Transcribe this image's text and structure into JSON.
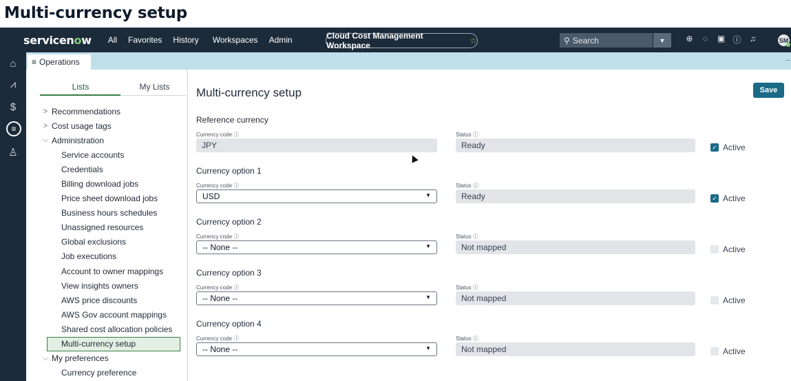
{
  "heading": "Multi-currency setup",
  "topbar": {
    "logo_text": "servicen",
    "logo_accent": "o",
    "logo_tail": "w",
    "nav": [
      "All",
      "Favorites",
      "History",
      "Workspaces",
      "Admin"
    ],
    "workspace": "Cloud Cost Management Workspace",
    "workspace_star": "☆",
    "search_placeholder": "Search",
    "avatar_initials": "SM"
  },
  "tab": {
    "label": "Operations"
  },
  "left": {
    "tabs": {
      "lists": "Lists",
      "my_lists": "My Lists"
    },
    "tree": [
      {
        "label": "Recommendations",
        "level": 0,
        "caret": ">"
      },
      {
        "label": "Cost usage tags",
        "level": 0,
        "caret": ">"
      },
      {
        "label": "Administration",
        "level": 0,
        "caret": "⌵"
      },
      {
        "label": "Service accounts",
        "level": 1
      },
      {
        "label": "Credentials",
        "level": 1
      },
      {
        "label": "Billing download jobs",
        "level": 1
      },
      {
        "label": "Price sheet download jobs",
        "level": 1
      },
      {
        "label": "Business hours schedules",
        "level": 1
      },
      {
        "label": "Unassigned resources",
        "level": 1
      },
      {
        "label": "Global exclusions",
        "level": 1
      },
      {
        "label": "Job executions",
        "level": 1
      },
      {
        "label": "Account to owner mappings",
        "level": 1
      },
      {
        "label": "View insights owners",
        "level": 1
      },
      {
        "label": "AWS price discounts",
        "level": 1
      },
      {
        "label": "AWS Gov account mappings",
        "level": 1
      },
      {
        "label": "Shared cost allocation policies",
        "level": 1
      },
      {
        "label": "Multi-currency setup",
        "level": 1,
        "selected": true
      },
      {
        "label": "My preferences",
        "level": 0,
        "caret": "⌵"
      },
      {
        "label": "Currency preference",
        "level": 1
      }
    ]
  },
  "main": {
    "title": "Multi-currency setup",
    "save_label": "Save",
    "currency_code_label": "Currency code ⓘ",
    "status_label": "Status ⓘ",
    "active_label": "Active",
    "sections": [
      {
        "title": "Reference currency",
        "code": "JPY",
        "editable": false,
        "status": "Ready",
        "active": true
      },
      {
        "title": "Currency option 1",
        "code": "USD",
        "editable": true,
        "status": "Ready",
        "active": true
      },
      {
        "title": "Currency option 2",
        "code": "-- None --",
        "editable": true,
        "status": "Not mapped",
        "active": false
      },
      {
        "title": "Currency option 3",
        "code": "-- None --",
        "editable": true,
        "status": "Not mapped",
        "active": false
      },
      {
        "title": "Currency option 4",
        "code": "-- None --",
        "editable": true,
        "status": "Not mapped",
        "active": false
      }
    ]
  }
}
